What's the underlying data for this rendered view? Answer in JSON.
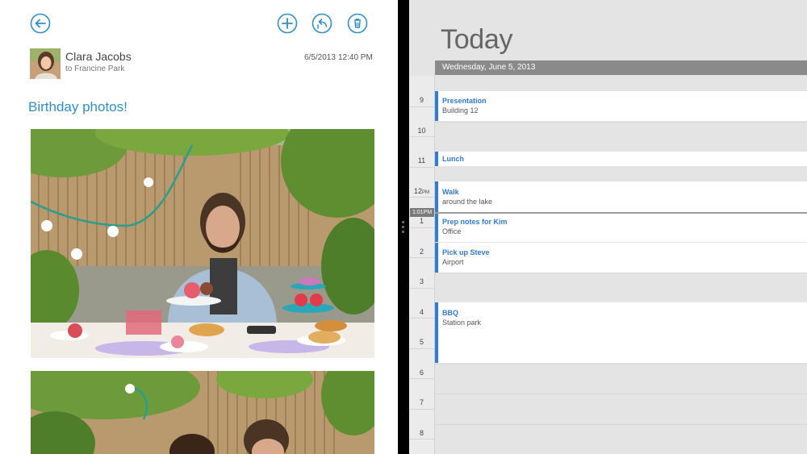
{
  "mail": {
    "sender_name": "Clara Jacobs",
    "recipient": "to Francine Park",
    "date": "6/5/2013",
    "time": "12:40 PM",
    "subject": "Birthday photos!",
    "commands": [
      "back-icon",
      "new-icon",
      "reply-icon",
      "delete-icon"
    ],
    "accent_color": "#2e8fcb"
  },
  "calendar": {
    "title": "Today",
    "date_header": "Wednesday, June 5, 2013",
    "hours": [
      {
        "label": "9",
        "suffix": ""
      },
      {
        "label": "10",
        "suffix": ""
      },
      {
        "label": "11",
        "suffix": ""
      },
      {
        "label": "12",
        "suffix": "PM"
      },
      {
        "label": "1",
        "suffix": ""
      },
      {
        "label": "2",
        "suffix": ""
      },
      {
        "label": "3",
        "suffix": ""
      },
      {
        "label": "4",
        "suffix": ""
      },
      {
        "label": "5",
        "suffix": ""
      },
      {
        "label": "6",
        "suffix": ""
      },
      {
        "label": "7",
        "suffix": ""
      },
      {
        "label": "8",
        "suffix": ""
      }
    ],
    "current_time": "1:01PM",
    "events": [
      {
        "title": "Presentation",
        "location": "Building 12"
      },
      {
        "title": "Lunch",
        "location": ""
      },
      {
        "title": "Walk",
        "location": "around the lake"
      },
      {
        "title": "Prep notes for Kim",
        "location": "Office"
      },
      {
        "title": "Pick up Steve",
        "location": "Airport"
      },
      {
        "title": "BBQ",
        "location": "Station park"
      }
    ],
    "event_color": "#2f7bd6"
  }
}
